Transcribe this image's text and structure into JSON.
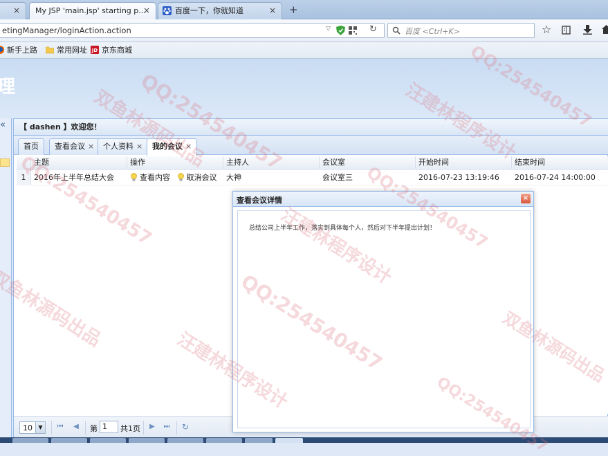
{
  "browser": {
    "tabs": [
      {
        "label": "My JSP 'main.jsp' starting p...",
        "close": "×"
      },
      {
        "label": "百度一下，你就知道",
        "close": "×"
      }
    ],
    "new_tab": "+",
    "url": "etingManager/loginAction.action",
    "search_placeholder": "百度 <Ctrl+K>",
    "bookmarks": [
      "新手上路",
      "常用网址",
      "京东商城"
    ]
  },
  "app": {
    "banner_title": "理",
    "collapse_glyph": "«",
    "welcome": "【 dashen 】欢迎您！",
    "tabs": [
      {
        "label": "首页",
        "closable": false
      },
      {
        "label": "查看会议",
        "closable": true
      },
      {
        "label": "个人资料",
        "closable": true
      },
      {
        "label": "我的会议",
        "closable": true,
        "active": true
      }
    ],
    "tab_close": "×"
  },
  "grid": {
    "columns": [
      "主题",
      "操作",
      "主持人",
      "会议室",
      "开始时间",
      "结束时间"
    ],
    "rows": [
      {
        "num": "1",
        "subject": "2016年上半年总结大会",
        "action_view": "查看内容",
        "action_cancel": "取消会议",
        "host": "大神",
        "room": "会议室三",
        "start": "2016-07-23 13:19:46",
        "end": "2016-07-24 14:00:00"
      }
    ]
  },
  "pager": {
    "page_size": "10",
    "page_label": "第",
    "page_value": "1",
    "page_total": "共1页",
    "first": "⏮",
    "prev": "◀",
    "next": "▶",
    "last": "⏭",
    "refresh": "↻"
  },
  "dialog": {
    "title": "查看会议详情",
    "close": "×",
    "content": "总结公司上半年工作，落实到具体每个人，然后对下半年提出计划！"
  },
  "watermarks": [
    "QQ:254540457",
    "汪建林程序设计",
    "双鱼林源码出品"
  ],
  "colors": {
    "accent": "#99bbe8",
    "header_bg": "#c9dcf3",
    "selection": "#fbe48d",
    "watermark": "#dc7882"
  }
}
